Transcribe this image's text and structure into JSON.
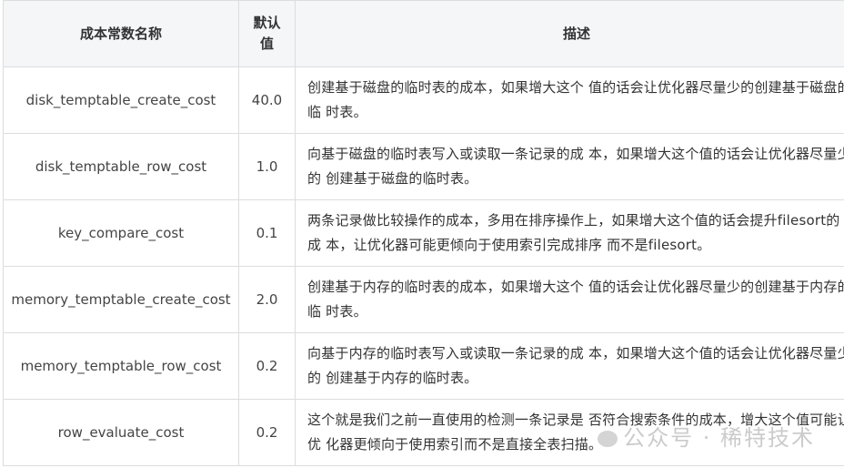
{
  "table": {
    "headers": {
      "name": "成本常数名称",
      "default_line1": "默认",
      "default_line2": "值",
      "description": "描述"
    },
    "rows": [
      {
        "name": "disk_temptable_create_cost",
        "default": "40.0",
        "description": "创建基于磁盘的临时表的成本，如果增大这个 值的话会让优化器尽量少的创建基于磁盘的临 时表。"
      },
      {
        "name": "disk_temptable_row_cost",
        "default": "1.0",
        "description": "向基于磁盘的临时表写入或读取一条记录的成 本，如果增大这个值的话会让优化器尽量少的 创建基于磁盘的临时表。"
      },
      {
        "name": "key_compare_cost",
        "default": "0.1",
        "description": "两条记录做比较操作的成本，多用在排序操作上，如果增大这个值的话会提升filesort的成 本，让优化器可能更倾向于使用索引完成排序 而不是filesort。"
      },
      {
        "name": "memory_temptable_create_cost",
        "default": "2.0",
        "description": "创建基于内存的临时表的成本，如果增大这个 值的话会让优化器尽量少的创建基于内存的临 时表。"
      },
      {
        "name": "memory_temptable_row_cost",
        "default": "0.2",
        "description": "向基于内存的临时表写入或读取一条记录的成 本，如果增大这个值的话会让优化器尽量少的 创建基于内存的临时表。"
      },
      {
        "name": "row_evaluate_cost",
        "default": "0.2",
        "description": "这个就是我们之前一直使用的检测一条记录是 否符合搜索条件的成本，增大这个值可能让优 化器更倾向于使用索引而不是直接全表扫描。"
      }
    ]
  },
  "watermark": {
    "text": "公众号 · 稀特技术"
  }
}
